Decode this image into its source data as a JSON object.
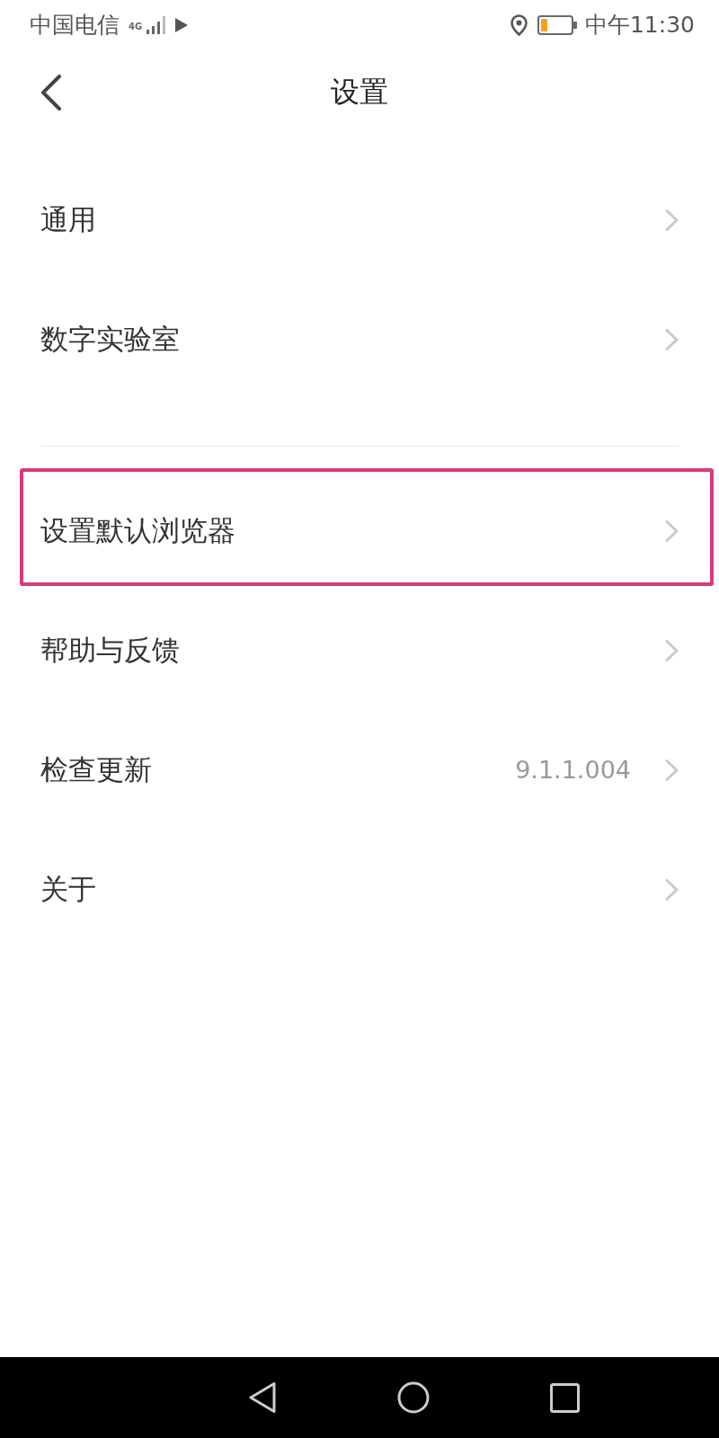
{
  "status_bar": {
    "carrier": "中国电信",
    "network": "4G",
    "time": "中午11:30"
  },
  "header": {
    "title": "设置"
  },
  "sections": [
    {
      "rows": [
        {
          "label": "通用",
          "highlighted": false
        },
        {
          "label": "数字实验室",
          "highlighted": false
        }
      ]
    },
    {
      "rows": [
        {
          "label": "设置默认浏览器",
          "highlighted": true
        },
        {
          "label": "帮助与反馈",
          "highlighted": false
        },
        {
          "label": "检查更新",
          "value": "9.1.1.004",
          "highlighted": false
        },
        {
          "label": "关于",
          "highlighted": false
        }
      ]
    }
  ]
}
